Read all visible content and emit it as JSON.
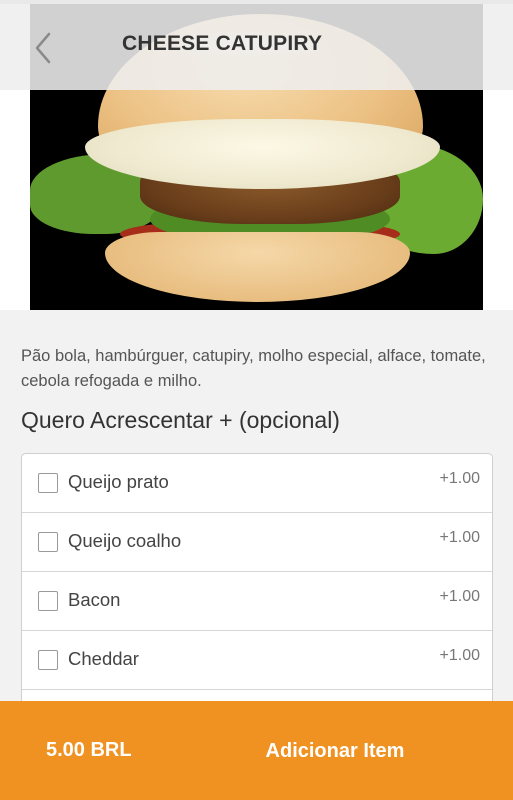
{
  "header": {
    "title": "CHEESE CATUPIRY",
    "back_icon": "chevron-left-icon"
  },
  "product": {
    "image": "burger-photo",
    "description": "Pão bola, hambúrguer, catupiry, molho especial, alface, tomate, cebola refogada e milho."
  },
  "extras": {
    "title": "Quero Acrescentar + (opcional)",
    "items": [
      {
        "label": "Queijo prato",
        "price": "+1.00",
        "checked": false
      },
      {
        "label": "Queijo coalho",
        "price": "+1.00",
        "checked": false
      },
      {
        "label": "Bacon",
        "price": "+1.00",
        "checked": false
      },
      {
        "label": "Cheddar",
        "price": "+1.00",
        "checked": false
      },
      {
        "label": "",
        "price": "",
        "checked": false
      }
    ]
  },
  "footer": {
    "total": "5.00 BRL",
    "add_label": "Adicionar Item"
  },
  "colors": {
    "accent": "#f09221",
    "background": "#f2f2f2"
  }
}
